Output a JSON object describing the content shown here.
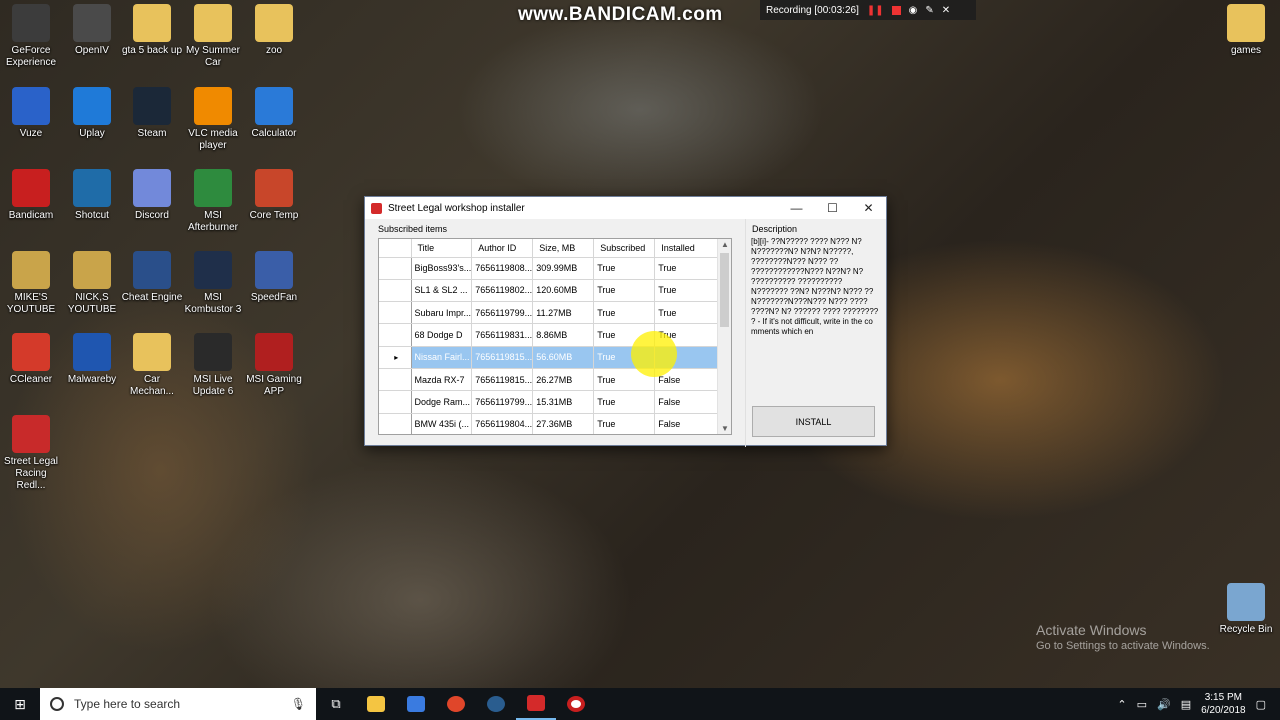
{
  "desktop_icons": [
    {
      "label": "GeForce Experience",
      "icon": "geforce-icon",
      "color": "#3c3c3c"
    },
    {
      "label": "OpenIV",
      "icon": "openiv-icon",
      "color": "#4a4a4a"
    },
    {
      "label": "gta 5 back up",
      "icon": "folder-icon",
      "color": "#e8c25c"
    },
    {
      "label": "My Summer Car",
      "icon": "folder-icon",
      "color": "#e8c25c"
    },
    {
      "label": "zoo",
      "icon": "folder-icon",
      "color": "#e8c25c"
    },
    {
      "label": "Vuze",
      "icon": "vuze-icon",
      "color": "#2a62c9"
    },
    {
      "label": "Uplay",
      "icon": "uplay-icon",
      "color": "#1f7ad8"
    },
    {
      "label": "Steam",
      "icon": "steam-icon",
      "color": "#1b2838"
    },
    {
      "label": "VLC media player",
      "icon": "vlc-icon",
      "color": "#f08a00"
    },
    {
      "label": "Calculator",
      "icon": "calculator-icon",
      "color": "#2a7ad8"
    },
    {
      "label": "Bandicam",
      "icon": "bandicam-icon",
      "color": "#c81f1f"
    },
    {
      "label": "Shotcut",
      "icon": "shotcut-icon",
      "color": "#1f6ca8"
    },
    {
      "label": "Discord",
      "icon": "discord-icon",
      "color": "#7289da"
    },
    {
      "label": "MSI Afterburner",
      "icon": "msi-afterburner-icon",
      "color": "#2e8b3e"
    },
    {
      "label": "Core Temp",
      "icon": "core-temp-icon",
      "color": "#c8462a"
    },
    {
      "label": "MIKE'S YOUTUBE",
      "icon": "folder-icon",
      "color": "#c9a44a"
    },
    {
      "label": "NICK,S YOUTUBE",
      "icon": "folder-icon",
      "color": "#c9a44a"
    },
    {
      "label": "Cheat Engine",
      "icon": "cheat-engine-icon",
      "color": "#2a4f8a"
    },
    {
      "label": "MSI Kombustor 3",
      "icon": "kombustor-icon",
      "color": "#1f2f4a"
    },
    {
      "label": "SpeedFan",
      "icon": "speedfan-icon",
      "color": "#3a5ea8"
    },
    {
      "label": "CCleaner",
      "icon": "ccleaner-icon",
      "color": "#d43a2a"
    },
    {
      "label": "Malwareby",
      "icon": "malwarebytes-icon",
      "color": "#1f56b0"
    },
    {
      "label": "Car Mechan...",
      "icon": "folder-icon",
      "color": "#e8c25c"
    },
    {
      "label": "MSI Live Update 6",
      "icon": "msi-live-icon",
      "color": "#2a2a2a"
    },
    {
      "label": "MSI Gaming APP",
      "icon": "msi-gaming-icon",
      "color": "#b01f1f"
    },
    {
      "label": "Street Legal Racing Redl...",
      "icon": "slr-icon",
      "color": "#c82a2a"
    },
    {
      "label": "games",
      "icon": "folder-icon",
      "color": "#e8c25c"
    },
    {
      "label": "Recycle Bin",
      "icon": "recycle-bin-icon",
      "color": "#7aa6d0"
    }
  ],
  "bandicam": {
    "logo": "www.BANDICAM.com",
    "status": "Recording [00:03:26]"
  },
  "window": {
    "title": "Street Legal workshop installer",
    "subscribed_label": "Subscribed items",
    "description_label": "Description",
    "description_text": "[b][i]- ??N????? ???? N??? N?N???????N? N?N? N?????, ????????N??? N??? ?? ????????????N??? N??N? N? ?????????? ?????????? N??????? ??N? N???N? N??? ??N???????N???N??? N??? ???? ????N? N? ?????? ???? ???????? ? - If it's not difficult, write in the comments which en",
    "install_label": "INSTALL",
    "columns": [
      "Title",
      "Author ID",
      "Size, MB",
      "Subscribed",
      "Installed"
    ],
    "rows": [
      {
        "title": "BigBoss93's...",
        "author": "7656119808...",
        "size": "309.99MB",
        "subscribed": "True",
        "installed": "True",
        "selected": false
      },
      {
        "title": "SL1 & SL2 ...",
        "author": "7656119802...",
        "size": "120.60MB",
        "subscribed": "True",
        "installed": "True",
        "selected": false
      },
      {
        "title": "Subaru Impr...",
        "author": "7656119799...",
        "size": "11.27MB",
        "subscribed": "True",
        "installed": "True",
        "selected": false
      },
      {
        "title": "68 Dodge D",
        "author": "7656119831...",
        "size": "8.86MB",
        "subscribed": "True",
        "installed": "True",
        "selected": false
      },
      {
        "title": "Nissan Fairl...",
        "author": "7656119815...",
        "size": "56.60MB",
        "subscribed": "True",
        "installed": "",
        "selected": true
      },
      {
        "title": "Mazda RX-7",
        "author": "7656119815...",
        "size": "26.27MB",
        "subscribed": "True",
        "installed": "False",
        "selected": false
      },
      {
        "title": "Dodge Ram...",
        "author": "7656119799...",
        "size": "15.31MB",
        "subscribed": "True",
        "installed": "False",
        "selected": false
      },
      {
        "title": "BMW 435i (...",
        "author": "7656119804...",
        "size": "27.36MB",
        "subscribed": "True",
        "installed": "False",
        "selected": false
      }
    ]
  },
  "activate": {
    "line1": "Activate Windows",
    "line2": "Go to Settings to activate Windows."
  },
  "taskbar": {
    "search_placeholder": "Type here to search",
    "time": "3:15 PM",
    "date": "6/20/2018"
  }
}
